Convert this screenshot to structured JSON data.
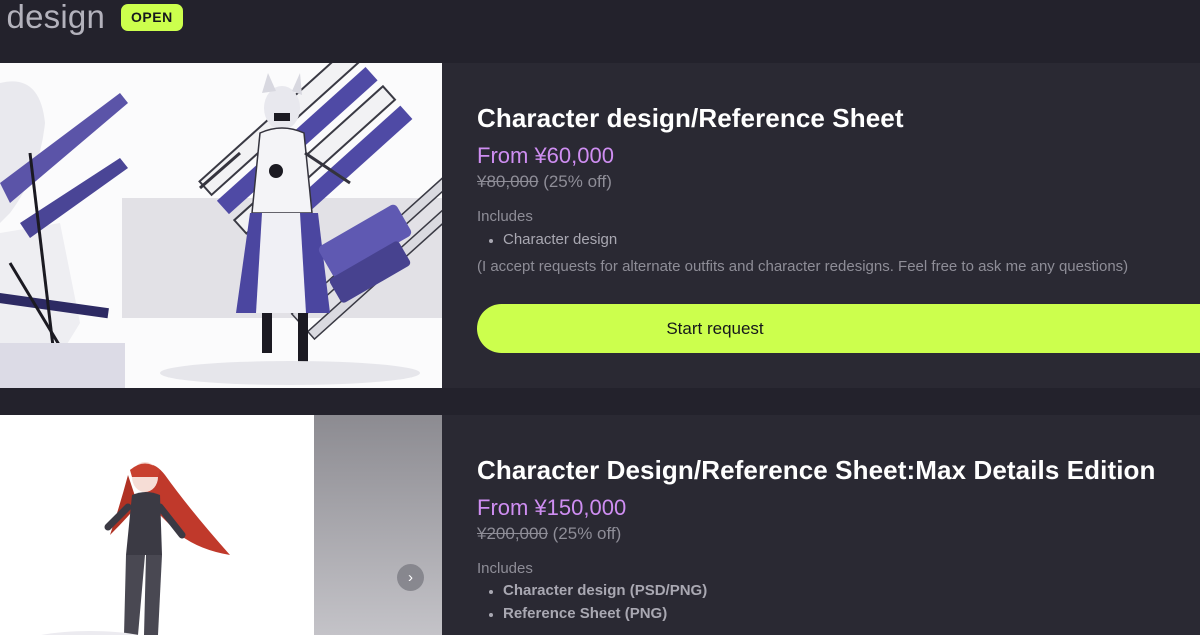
{
  "header": {
    "section_title": "r design",
    "status_badge": "OPEN"
  },
  "cards": [
    {
      "title": "Character design/Reference Sheet",
      "price": "From ¥60,000",
      "original_price": "¥80,000",
      "discount": "(25% off)",
      "includes_label": "Includes",
      "includes": [
        "Character design"
      ],
      "note": "(I accept requests for alternate outfits and character redesigns. Feel free to ask me any questions)",
      "cta_label": "Start request"
    },
    {
      "title": "Character Design/Reference Sheet:Max Details Edition",
      "price": "From ¥150,000",
      "original_price": "¥200,000",
      "discount": "(25% off)",
      "includes_label": "Includes",
      "includes": [
        "Character design (PSD/PNG)",
        "Reference Sheet (PNG)"
      ],
      "carousel_next_icon": "›"
    }
  ],
  "colors": {
    "background": "#23222c",
    "card": "#2a2933",
    "accent": "#ccff4d",
    "price": "#cf8ef2"
  },
  "icons": {
    "carousel_next": "chevron-right-icon"
  }
}
